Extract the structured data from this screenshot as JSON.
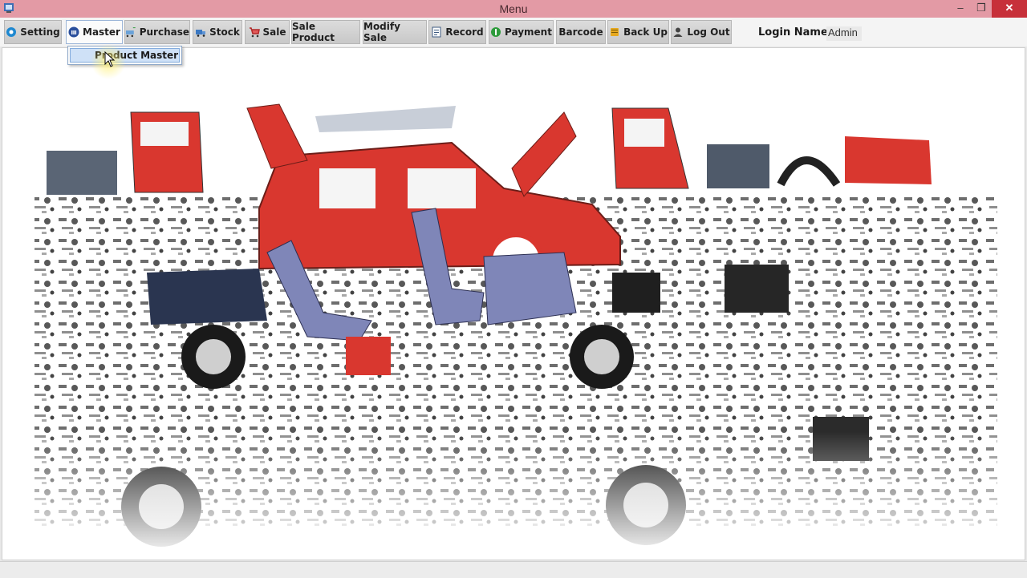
{
  "window": {
    "title": "Menu",
    "min_icon": "minimize-icon",
    "max_icon": "restore-icon",
    "close_icon": "close-icon",
    "min_glyph": "–",
    "max_glyph": "❐",
    "close_glyph": "✕"
  },
  "menu": {
    "items": [
      {
        "label": "Setting",
        "icon": "gear-icon"
      },
      {
        "label": "Master",
        "icon": "bank-icon"
      },
      {
        "label": "Purchase",
        "icon": "cart-add-icon"
      },
      {
        "label": "Stock",
        "icon": "truck-icon"
      },
      {
        "label": "Sale",
        "icon": "cart-icon"
      },
      {
        "label": "Sale Product",
        "icon": ""
      },
      {
        "label": "Modify Sale",
        "icon": ""
      },
      {
        "label": "Record",
        "icon": "document-icon"
      },
      {
        "label": "Payment",
        "icon": "money-icon"
      },
      {
        "label": "Barcode",
        "icon": ""
      },
      {
        "label": "Back Up",
        "icon": "database-icon"
      },
      {
        "label": "Log Out",
        "icon": "user-icon"
      }
    ],
    "dropdown": {
      "item": "Product Master"
    }
  },
  "login": {
    "label": "Login Name",
    "value": "Admin"
  },
  "colors": {
    "titlebar": "#e39aa5",
    "close_button": "#c7303a",
    "car_red": "#d9372f",
    "seat_blue": "#7f86b8"
  }
}
